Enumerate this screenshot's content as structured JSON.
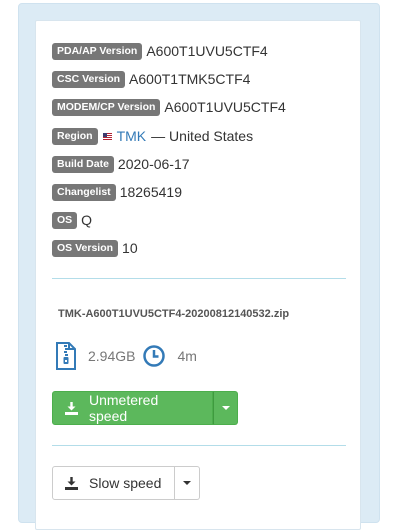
{
  "firmware": {
    "rows": [
      {
        "label": "PDA/AP Version",
        "value": "A600T1UVU5CTF4"
      },
      {
        "label": "CSC Version",
        "value": "A600T1TMK5CTF4"
      },
      {
        "label": "MODEM/CP Version",
        "value": "A600T1UVU5CTF4"
      },
      {
        "label": "Region",
        "code": "TMK",
        "value": "— United States"
      },
      {
        "label": "Build Date",
        "value": "2020-06-17"
      },
      {
        "label": "Changelist",
        "value": "18265419"
      },
      {
        "label": "OS",
        "value": "Q"
      },
      {
        "label": "OS Version",
        "value": "10"
      }
    ]
  },
  "download": {
    "filename": "TMK-A600T1UVU5CTF4-20200812140532.zip",
    "size": "2.94GB",
    "time": "4m",
    "size_icon": "zip-file-icon",
    "time_icon": "clock-icon",
    "unmetered_label": "Unmetered speed",
    "slow_label": "Slow speed"
  },
  "colors": {
    "label_bg": "#777777",
    "link": "#337ab7",
    "success": "#5cb85c",
    "divider": "#b3dde9",
    "panel_bg": "#dcebf5",
    "icon_blue": "#337ab7"
  }
}
